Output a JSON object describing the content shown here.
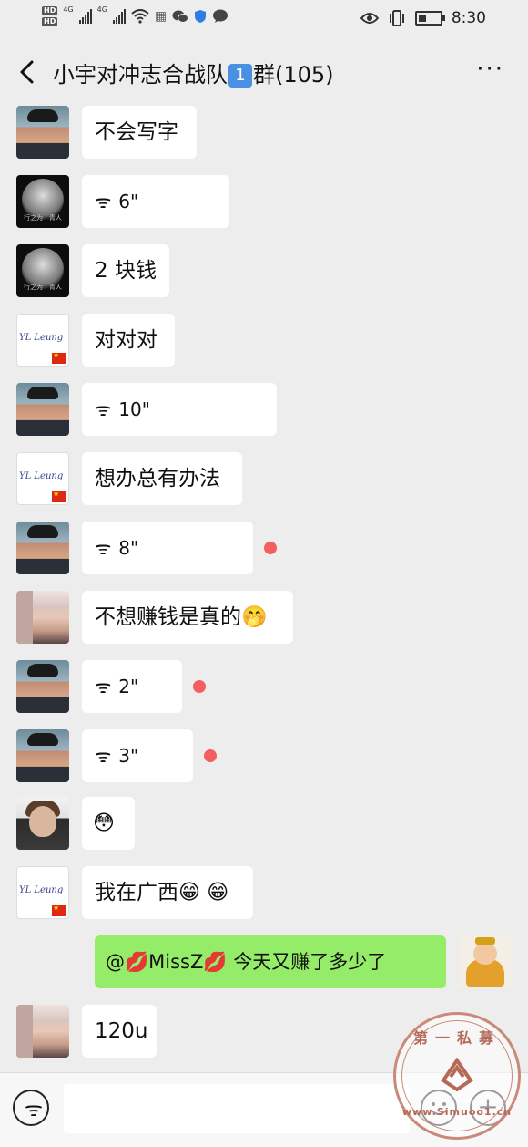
{
  "status_bar": {
    "network_badges": [
      "HD",
      "HD"
    ],
    "network_types": [
      "4G",
      "4G"
    ],
    "time": "8:30"
  },
  "header": {
    "title_prefix": "小宇对冲志合战队",
    "title_badge": "1",
    "title_suffix": "群(105)",
    "more_label": "···"
  },
  "messages": [
    {
      "text": "不会写字"
    },
    {
      "duration": "6\""
    },
    {
      "text": "2 块钱"
    },
    {
      "text": "对对对"
    },
    {
      "duration": "10\""
    },
    {
      "text": "想办总有办法"
    },
    {
      "duration": "8\""
    },
    {
      "text": "不想赚钱是真的",
      "emoji": "🤭"
    },
    {
      "duration": "2\""
    },
    {
      "duration": "3\""
    },
    {
      "emoji": "😳"
    },
    {
      "text": "我在广西",
      "emoji": "😁 😁"
    },
    {
      "mention_prefix": "@",
      "mention_lips": "💋",
      "mention_name": "MissZ",
      "text": "今天又赚了多少了"
    },
    {
      "text": "120u"
    }
  ],
  "avatars": {
    "yl_text": "YL Leung",
    "dark_text": "行之为 . 青人"
  },
  "input_bar": {
    "placeholder": "",
    "plus_label": "+"
  },
  "watermark": {
    "top_text": "第一私募",
    "bottom_text": "www.Simuoo1.cn"
  },
  "colors": {
    "background": "#ededed",
    "bubble_in": "#ffffff",
    "bubble_out": "#95ec69",
    "unread_dot": "#f35e5e",
    "title_badge": "#4a90e2"
  }
}
